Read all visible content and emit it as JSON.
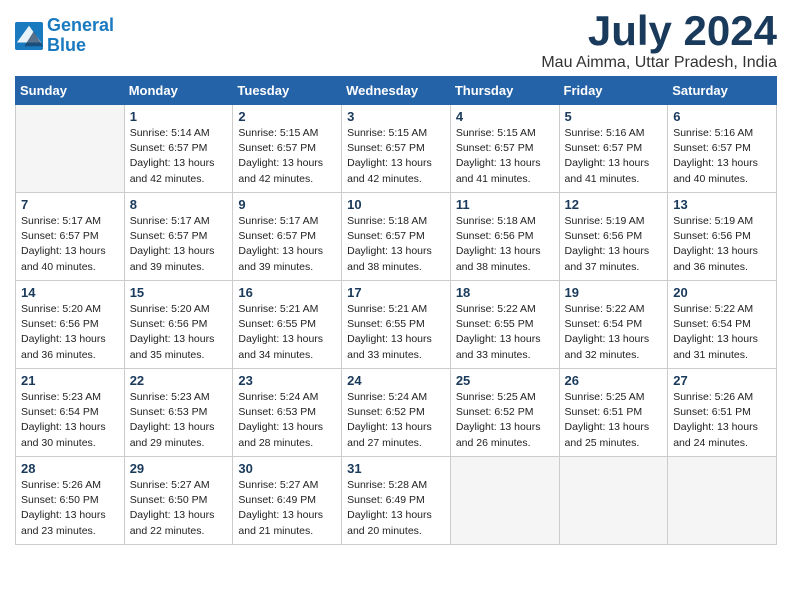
{
  "logo": {
    "line1": "General",
    "line2": "Blue"
  },
  "title": "July 2024",
  "location": "Mau Aimma, Uttar Pradesh, India",
  "days_header": [
    "Sunday",
    "Monday",
    "Tuesday",
    "Wednesday",
    "Thursday",
    "Friday",
    "Saturday"
  ],
  "weeks": [
    [
      {
        "day": "",
        "info": ""
      },
      {
        "day": "1",
        "info": "Sunrise: 5:14 AM\nSunset: 6:57 PM\nDaylight: 13 hours\nand 42 minutes."
      },
      {
        "day": "2",
        "info": "Sunrise: 5:15 AM\nSunset: 6:57 PM\nDaylight: 13 hours\nand 42 minutes."
      },
      {
        "day": "3",
        "info": "Sunrise: 5:15 AM\nSunset: 6:57 PM\nDaylight: 13 hours\nand 42 minutes."
      },
      {
        "day": "4",
        "info": "Sunrise: 5:15 AM\nSunset: 6:57 PM\nDaylight: 13 hours\nand 41 minutes."
      },
      {
        "day": "5",
        "info": "Sunrise: 5:16 AM\nSunset: 6:57 PM\nDaylight: 13 hours\nand 41 minutes."
      },
      {
        "day": "6",
        "info": "Sunrise: 5:16 AM\nSunset: 6:57 PM\nDaylight: 13 hours\nand 40 minutes."
      }
    ],
    [
      {
        "day": "7",
        "info": "Sunrise: 5:17 AM\nSunset: 6:57 PM\nDaylight: 13 hours\nand 40 minutes."
      },
      {
        "day": "8",
        "info": "Sunrise: 5:17 AM\nSunset: 6:57 PM\nDaylight: 13 hours\nand 39 minutes."
      },
      {
        "day": "9",
        "info": "Sunrise: 5:17 AM\nSunset: 6:57 PM\nDaylight: 13 hours\nand 39 minutes."
      },
      {
        "day": "10",
        "info": "Sunrise: 5:18 AM\nSunset: 6:57 PM\nDaylight: 13 hours\nand 38 minutes."
      },
      {
        "day": "11",
        "info": "Sunrise: 5:18 AM\nSunset: 6:56 PM\nDaylight: 13 hours\nand 38 minutes."
      },
      {
        "day": "12",
        "info": "Sunrise: 5:19 AM\nSunset: 6:56 PM\nDaylight: 13 hours\nand 37 minutes."
      },
      {
        "day": "13",
        "info": "Sunrise: 5:19 AM\nSunset: 6:56 PM\nDaylight: 13 hours\nand 36 minutes."
      }
    ],
    [
      {
        "day": "14",
        "info": "Sunrise: 5:20 AM\nSunset: 6:56 PM\nDaylight: 13 hours\nand 36 minutes."
      },
      {
        "day": "15",
        "info": "Sunrise: 5:20 AM\nSunset: 6:56 PM\nDaylight: 13 hours\nand 35 minutes."
      },
      {
        "day": "16",
        "info": "Sunrise: 5:21 AM\nSunset: 6:55 PM\nDaylight: 13 hours\nand 34 minutes."
      },
      {
        "day": "17",
        "info": "Sunrise: 5:21 AM\nSunset: 6:55 PM\nDaylight: 13 hours\nand 33 minutes."
      },
      {
        "day": "18",
        "info": "Sunrise: 5:22 AM\nSunset: 6:55 PM\nDaylight: 13 hours\nand 33 minutes."
      },
      {
        "day": "19",
        "info": "Sunrise: 5:22 AM\nSunset: 6:54 PM\nDaylight: 13 hours\nand 32 minutes."
      },
      {
        "day": "20",
        "info": "Sunrise: 5:22 AM\nSunset: 6:54 PM\nDaylight: 13 hours\nand 31 minutes."
      }
    ],
    [
      {
        "day": "21",
        "info": "Sunrise: 5:23 AM\nSunset: 6:54 PM\nDaylight: 13 hours\nand 30 minutes."
      },
      {
        "day": "22",
        "info": "Sunrise: 5:23 AM\nSunset: 6:53 PM\nDaylight: 13 hours\nand 29 minutes."
      },
      {
        "day": "23",
        "info": "Sunrise: 5:24 AM\nSunset: 6:53 PM\nDaylight: 13 hours\nand 28 minutes."
      },
      {
        "day": "24",
        "info": "Sunrise: 5:24 AM\nSunset: 6:52 PM\nDaylight: 13 hours\nand 27 minutes."
      },
      {
        "day": "25",
        "info": "Sunrise: 5:25 AM\nSunset: 6:52 PM\nDaylight: 13 hours\nand 26 minutes."
      },
      {
        "day": "26",
        "info": "Sunrise: 5:25 AM\nSunset: 6:51 PM\nDaylight: 13 hours\nand 25 minutes."
      },
      {
        "day": "27",
        "info": "Sunrise: 5:26 AM\nSunset: 6:51 PM\nDaylight: 13 hours\nand 24 minutes."
      }
    ],
    [
      {
        "day": "28",
        "info": "Sunrise: 5:26 AM\nSunset: 6:50 PM\nDaylight: 13 hours\nand 23 minutes."
      },
      {
        "day": "29",
        "info": "Sunrise: 5:27 AM\nSunset: 6:50 PM\nDaylight: 13 hours\nand 22 minutes."
      },
      {
        "day": "30",
        "info": "Sunrise: 5:27 AM\nSunset: 6:49 PM\nDaylight: 13 hours\nand 21 minutes."
      },
      {
        "day": "31",
        "info": "Sunrise: 5:28 AM\nSunset: 6:49 PM\nDaylight: 13 hours\nand 20 minutes."
      },
      {
        "day": "",
        "info": ""
      },
      {
        "day": "",
        "info": ""
      },
      {
        "day": "",
        "info": ""
      }
    ]
  ]
}
